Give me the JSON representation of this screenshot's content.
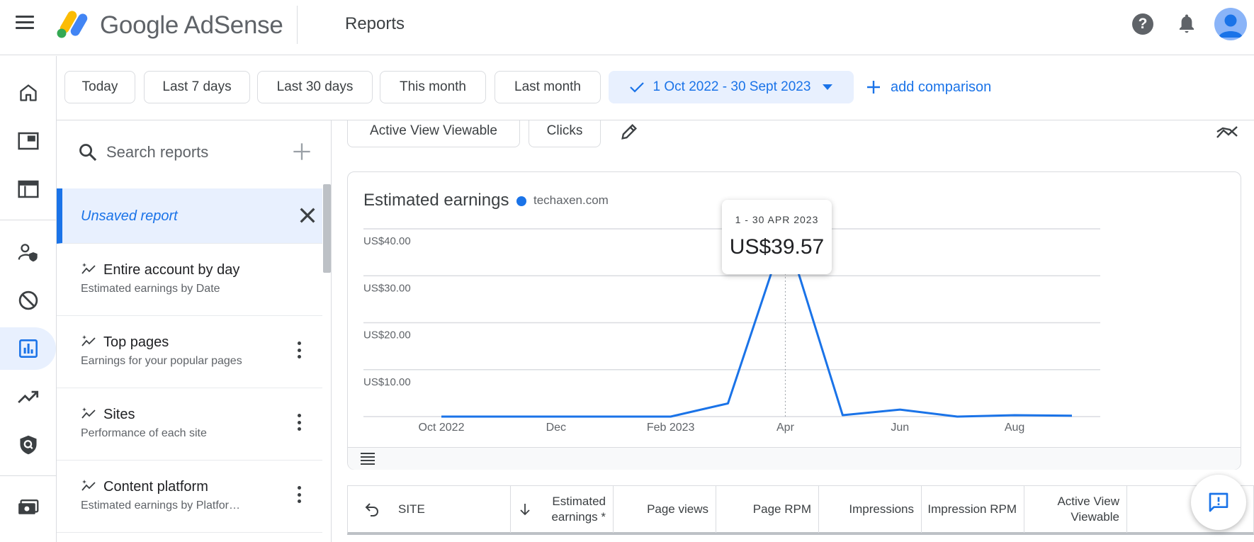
{
  "app": {
    "brand": "Google AdSense",
    "page_title": "Reports"
  },
  "topbar": {
    "help_icon": "help-icon",
    "notifications_icon": "bell-icon",
    "avatar_icon": "account-avatar"
  },
  "leftnav": {
    "items": [
      {
        "name": "home-icon",
        "active": false
      },
      {
        "name": "sites-icon",
        "active": false
      },
      {
        "name": "ads-icon",
        "active": false
      },
      {
        "name": "privacy-messaging-icon",
        "active": false
      },
      {
        "name": "blocking-controls-icon",
        "active": false
      },
      {
        "name": "reports-icon",
        "active": true
      },
      {
        "name": "optimization-icon",
        "active": false
      },
      {
        "name": "policy-center-icon",
        "active": false
      },
      {
        "name": "payments-icon",
        "active": false
      }
    ]
  },
  "filters": {
    "chips": [
      "Today",
      "Last 7 days",
      "Last 30 days",
      "This month",
      "Last month"
    ],
    "date_range": "1 Oct 2022 - 30 Sept 2023",
    "add_comparison": "add comparison"
  },
  "sidepanel": {
    "search_placeholder": "Search reports",
    "unsaved": "Unsaved report",
    "reports": [
      {
        "title": "Entire account by day",
        "subtitle": "Estimated earnings by Date"
      },
      {
        "title": "Top pages",
        "subtitle": "Earnings for your popular pages"
      },
      {
        "title": "Sites",
        "subtitle": "Performance of each site"
      },
      {
        "title": "Content platform",
        "subtitle": "Estimated earnings by Platfor…"
      }
    ]
  },
  "metrics": {
    "chips": [
      "Active View Viewable",
      "Clicks"
    ]
  },
  "chart": {
    "title": "Estimated earnings",
    "legend": "techaxen.com",
    "tooltip": {
      "date": "1 - 30 APR 2023",
      "value": "US$39.57"
    }
  },
  "chart_data": {
    "type": "line",
    "title": "Estimated earnings",
    "series": [
      {
        "name": "techaxen.com",
        "x": [
          "Oct 2022",
          "Nov 2022",
          "Dec 2022",
          "Jan 2023",
          "Feb 2023",
          "Mar 2023",
          "Apr 2023",
          "May 2023",
          "Jun 2023",
          "Jul 2023",
          "Aug 2023",
          "Sep 2023"
        ],
        "values": [
          0,
          0,
          0,
          0,
          0,
          2.8,
          39.57,
          0.3,
          1.5,
          0,
          0.3,
          0.2
        ]
      }
    ],
    "x_tick_labels": [
      "Oct 2022",
      "Dec",
      "Feb 2023",
      "Apr",
      "Jun",
      "Aug"
    ],
    "y_tick_labels": [
      "US$10.00",
      "US$20.00",
      "US$30.00",
      "US$40.00"
    ],
    "y_ticks": [
      10,
      20,
      30,
      40
    ],
    "ylim": [
      0,
      40
    ],
    "grid": true,
    "line_color": "#1a73e8",
    "highlight_index": 6
  },
  "table": {
    "columns": [
      "SITE",
      "Estimated earnings *",
      "Page views",
      "Page RPM",
      "Impressions",
      "Impression RPM",
      "Active View Viewable"
    ]
  },
  "colors": {
    "accent": "#1a73e8",
    "selected_bg": "#e8f0fe",
    "border": "#dadce0"
  }
}
